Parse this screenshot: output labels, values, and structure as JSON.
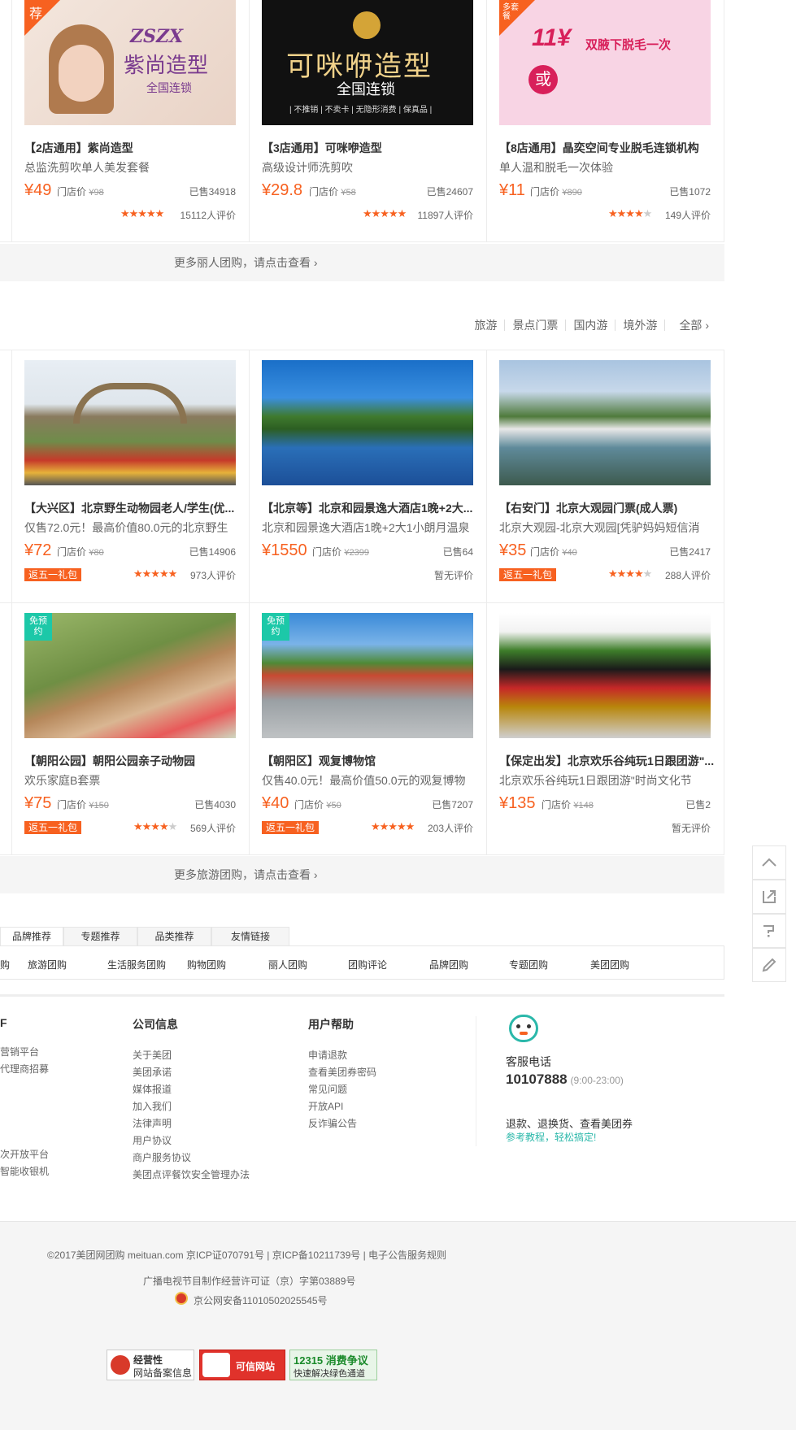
{
  "row1": [
    {
      "title": "【2店通用】紫尚造型",
      "sub": "总监洗剪吹单人美发套餐",
      "price": "¥49",
      "store_label": "门店价",
      "store_price": "¥98",
      "sold": "已售34918",
      "stars": 5,
      "reviews": "15112人评价",
      "badge": "荐",
      "img_text1": "ZSZX",
      "img_text2": "紫尚造型",
      "img_text3": "全国连锁"
    },
    {
      "title": "【3店通用】可咪咿造型",
      "sub": "高级设计师洗剪吹",
      "price": "¥29.8",
      "store_label": "门店价",
      "store_price": "¥58",
      "sold": "已售24607",
      "stars": 5,
      "reviews": "11897人评价",
      "img_text1": "可咪咿造型",
      "img_text2": "全国连锁",
      "img_text3": "| 不推销 | 不卖卡 | 无隐形消费 | 保真品 |"
    },
    {
      "title": "【8店通用】晶奕空间专业脱毛连锁机构",
      "sub": "单人温和脱毛一次体验",
      "price": "¥11",
      "store_label": "门店价",
      "store_price": "¥890",
      "sold": "已售1072",
      "stars": 4,
      "reviews": "149人评价",
      "badge": "多套餐",
      "img_text1": "11¥",
      "img_text2": "双腋下脱毛一次",
      "img_text3": "或"
    }
  ],
  "more1": "更多丽人团购，请点击查看 ›",
  "cat_nav": [
    "旅游",
    "景点门票",
    "国内游",
    "境外游",
    "全部 ›"
  ],
  "row2": [
    {
      "title": "【大兴区】北京野生动物园老人/学生(优...",
      "sub": "仅售72.0元！最高价值80.0元的北京野生",
      "price": "¥72",
      "store_label": "门店价",
      "store_price": "¥80",
      "sold": "已售14906",
      "stars": 5,
      "reviews": "973人评价",
      "gift": "返五一礼包"
    },
    {
      "title": "【北京等】北京和园景逸大酒店1晚+2大...",
      "sub": "北京和园景逸大酒店1晚+2大1小朗月温泉",
      "price": "¥1550",
      "store_label": "门店价",
      "store_price": "¥2399",
      "sold": "已售64",
      "stars": 0,
      "reviews": "暂无评价"
    },
    {
      "title": "【右安门】北京大观园门票(成人票)",
      "sub": "北京大观园-北京大观园[凭驴妈妈短信消",
      "price": "¥35",
      "store_label": "门店价",
      "store_price": "¥40",
      "sold": "已售2417",
      "stars": 4.5,
      "reviews": "288人评价",
      "gift": "返五一礼包"
    }
  ],
  "row3": [
    {
      "title": "【朝阳公园】朝阳公园亲子动物园",
      "sub": "欢乐家庭B套票",
      "price": "¥75",
      "store_label": "门店价",
      "store_price": "¥150",
      "sold": "已售4030",
      "stars": 4,
      "reviews": "569人评价",
      "gift": "返五一礼包",
      "badge": "免预约"
    },
    {
      "title": "【朝阳区】观复博物馆",
      "sub": "仅售40.0元！最高价值50.0元的观复博物",
      "price": "¥40",
      "store_label": "门店价",
      "store_price": "¥50",
      "sold": "已售7207",
      "stars": 5,
      "reviews": "203人评价",
      "gift": "返五一礼包",
      "badge": "免预约"
    },
    {
      "title": "【保定出发】北京欢乐谷纯玩1日跟团游\"...",
      "sub": "北京欢乐谷纯玩1日跟团游\"时尚文化节",
      "price": "¥135",
      "store_label": "门店价",
      "store_price": "¥148",
      "sold": "已售2",
      "stars": 0,
      "reviews": "暂无评价"
    }
  ],
  "more2": "更多旅游团购，请点击查看 ›",
  "tabs": [
    "品牌推荐",
    "专题推荐",
    "品类推荐",
    "友情链接"
  ],
  "links": [
    "购",
    "旅游团购",
    "生活服务团购",
    "购物团购",
    "丽人团购",
    "团购评论",
    "品牌团购",
    "专题团购",
    "美团团购"
  ],
  "footer": {
    "col0": {
      "title": "F",
      "items": [
        "",
        "营销平台",
        "代理商招募",
        "",
        "",
        "",
        "",
        "",
        "次开放平台",
        "智能收银机"
      ]
    },
    "col1": {
      "title": "公司信息",
      "items": [
        "关于美团",
        "美团承诺",
        "媒体报道",
        "加入我们",
        "法律声明",
        "用户协议",
        "商户服务协议",
        "美团点评餐饮安全管理办法"
      ]
    },
    "col2": {
      "title": "用户帮助",
      "items": [
        "申请退款",
        "查看美团券密码",
        "常见问题",
        "开放API",
        "反诈骗公告"
      ]
    },
    "service": {
      "label": "客服电话",
      "phone": "10107888",
      "hours": "(9:00-23:00)",
      "line1": "退款、退换货、查看美团券",
      "line2": "参考教程，轻松搞定!"
    }
  },
  "copyright": {
    "line1": "©2017美团网团购 meituan.com 京ICP证070791号 | 京ICP备10211739号 | 电子公告服务规则",
    "line2": "广播电视节目制作经营许可证（京）字第03889号",
    "line3": "京公网安备11010502025545号",
    "badge1a": "经营性",
    "badge1b": "网站备案信息",
    "badge2": "可信网站",
    "badge3a": "12315 消费争议",
    "badge3b": "快速解决绿色通道"
  },
  "colors": {
    "accent": "#f76120",
    "teal": "#2bb8aa",
    "badge_green": "#1cc8a8"
  }
}
